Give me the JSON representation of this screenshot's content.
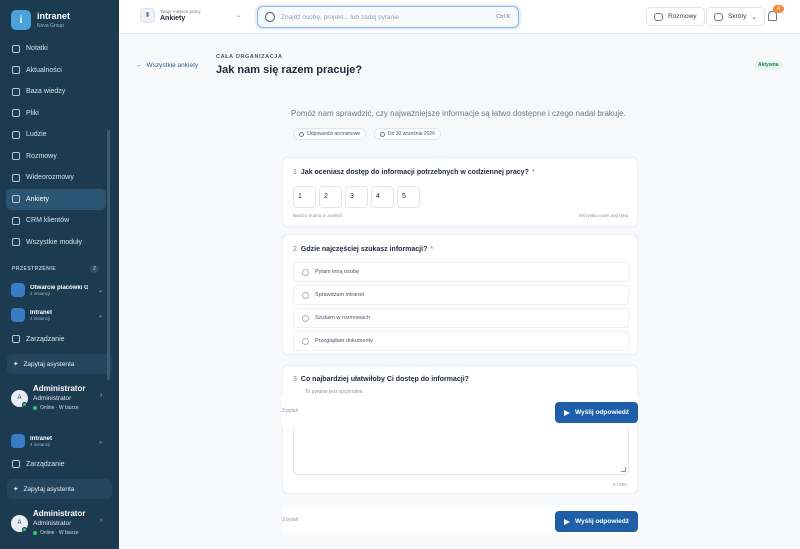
{
  "app": {
    "logo_letter": "i",
    "name": "intranet",
    "org": "Nova Group"
  },
  "sidebar": {
    "items": [
      {
        "label": "Notatki",
        "icon": "note-icon"
      },
      {
        "label": "Aktualności",
        "icon": "news-icon"
      },
      {
        "label": "Baza wiedzy",
        "icon": "book-icon"
      },
      {
        "label": "Pliki",
        "icon": "file-icon"
      },
      {
        "label": "Ludzie",
        "icon": "people-icon"
      },
      {
        "label": "Rozmowy",
        "icon": "chat-icon"
      },
      {
        "label": "Wideorozmowy",
        "icon": "video-icon"
      },
      {
        "label": "Ankiety",
        "icon": "poll-icon"
      },
      {
        "label": "CRM klientów",
        "icon": "crm-icon"
      },
      {
        "label": "Wszystkie moduły",
        "icon": "grid-icon"
      }
    ],
    "active_index": 7,
    "spaces_label": "PRZESTRZENIE",
    "spaces_count": "2",
    "spaces": [
      {
        "title": "Otwarcie placówki Gdańsk",
        "sub": "4 instancji"
      },
      {
        "title": "Intranet",
        "sub": "4 instancji"
      }
    ],
    "manage_label": "Zarządzanie",
    "ask_label": "Zapytaj asystenta",
    "user": {
      "initial": "A",
      "name": "Administrator",
      "role": "Administrator",
      "status": "Online · W biurze"
    },
    "repeat_space": {
      "title": "Intranet",
      "sub": "4 instancji"
    }
  },
  "topbar": {
    "workspace_sub": "Twoje miejsce pracy",
    "workspace_name": "Ankiety",
    "search_placeholder": "Znajdź osobę, projekt... lub zadaj pytanie",
    "search_kbd": "Ctrl K",
    "chat_label": "Rozmowy",
    "shortcuts_label": "Skróty",
    "notifications_count": "4"
  },
  "page": {
    "back_label": "Wszystkie ankiety",
    "eyebrow": "CAŁA ORGANIZACJA",
    "title": "Jak nam się razem pracuje?",
    "status": "Aktywna",
    "intro": "Pomóż nam sprawdzić, czy najważniejsze informacje są łatwo dostępne i czego nadal brakuje.",
    "chip_anon": "Odpowiedzi anonimowe",
    "chip_deadline": "Do 30 września 2026"
  },
  "questions": [
    {
      "num": "1",
      "text": "Jak oceniasz dostęp do informacji potrzebnych w codziennej pracy?",
      "required": "*",
      "scale": [
        "1",
        "2",
        "3",
        "4",
        "5"
      ],
      "min_label": "Bardzo trudno je znaleźć",
      "max_label": "Wszystko mam pod ręką"
    },
    {
      "num": "2",
      "text": "Gdzie najczęściej szukasz informacji?",
      "required": "*",
      "options": [
        "Pytam inną osobę",
        "Sprawdzam intranet",
        "Szukam w rozmowach",
        "Przeglądam dokumenty"
      ]
    },
    {
      "num": "3",
      "text": "Co najbardziej ułatwiłoby Ci dostęp do informacji?",
      "hint": "To pytanie jest opcjonalne.",
      "char_count": "0 / 800"
    }
  ],
  "footer": {
    "progress_text": "3 pytań",
    "submit_label": "Wyślij odpowiedź"
  }
}
